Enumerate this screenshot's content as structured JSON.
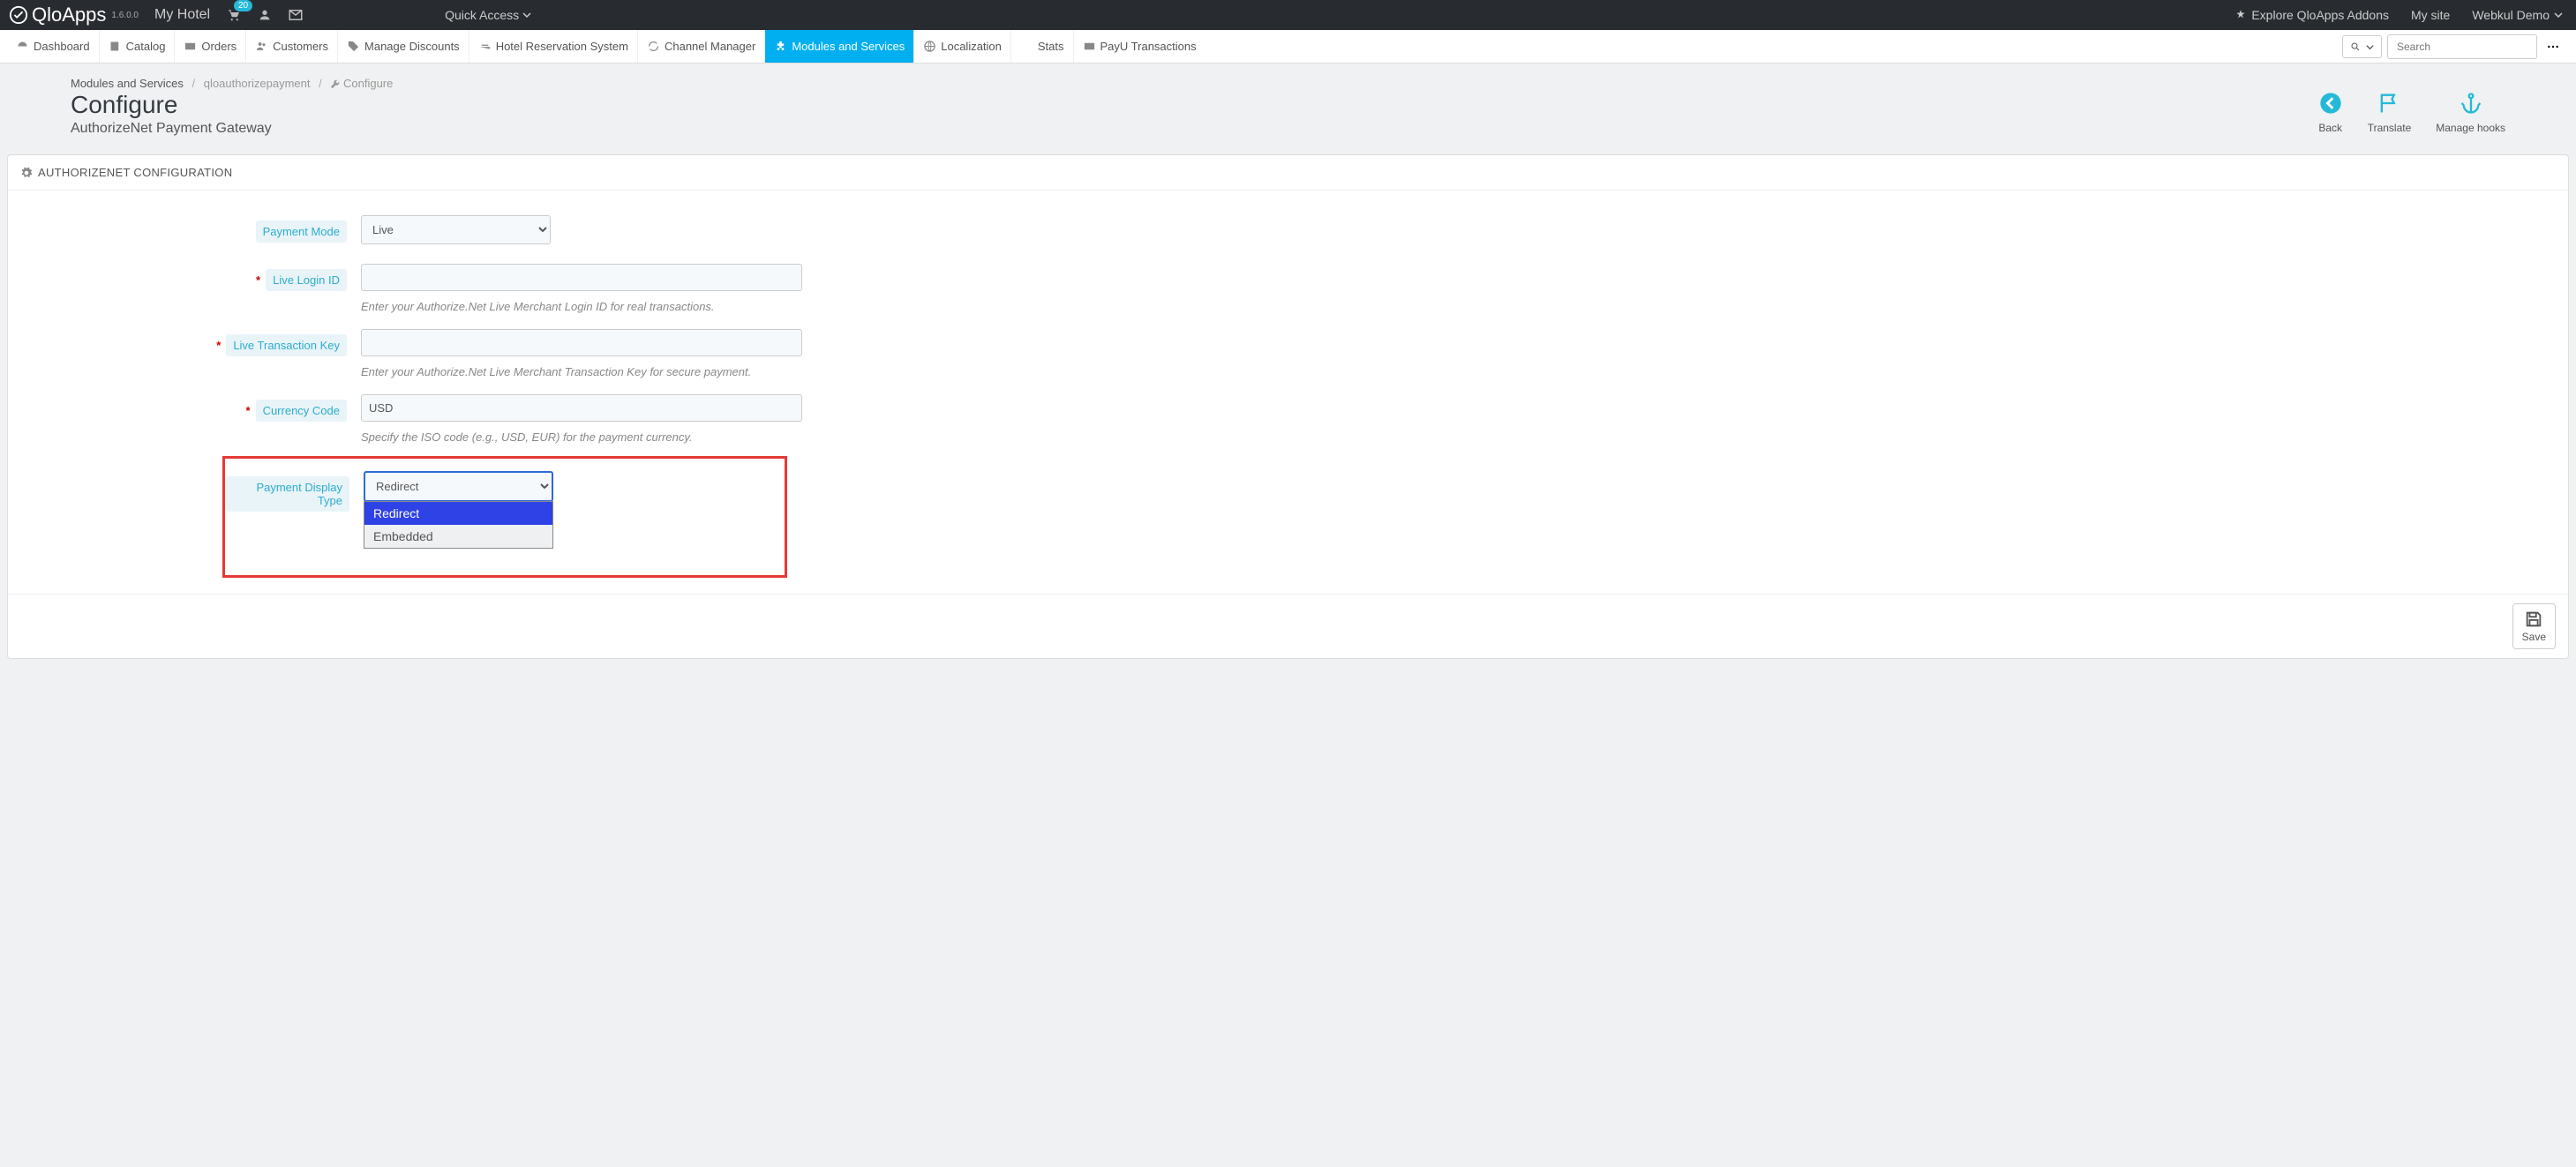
{
  "topbar": {
    "brand": "QloApps",
    "version": "1.6.0.0",
    "hotel": "My Hotel",
    "cart_count": "20",
    "quick_access": "Quick Access",
    "addons": "Explore QloApps Addons",
    "mysite": "My site",
    "user": "Webkul Demo"
  },
  "nav": {
    "items": [
      "Dashboard",
      "Catalog",
      "Orders",
      "Customers",
      "Manage Discounts",
      "Hotel Reservation System",
      "Channel Manager",
      "Modules and Services",
      "Localization",
      "Stats",
      "PayU Transactions"
    ],
    "search_placeholder": "Search"
  },
  "breadcrumb": {
    "root": "Modules and Services",
    "module": "qloauthorizepayment",
    "page": "Configure"
  },
  "header": {
    "title": "Configure",
    "subtitle": "AuthorizeNet Payment Gateway",
    "toolbar": {
      "back": "Back",
      "translate": "Translate",
      "hooks": "Manage hooks"
    }
  },
  "panel": {
    "title": "AUTHORIZENET CONFIGURATION",
    "fields": {
      "payment_mode": {
        "label": "Payment Mode",
        "value": "Live"
      },
      "login_id": {
        "label": "Live Login ID",
        "help": "Enter your Authorize.Net Live Merchant Login ID for real transactions."
      },
      "txn_key": {
        "label": "Live Transaction Key",
        "help": "Enter your Authorize.Net Live Merchant Transaction Key for secure payment."
      },
      "currency": {
        "label": "Currency Code",
        "value": "USD",
        "help": "Specify the ISO code (e.g., USD, EUR) for the payment currency."
      },
      "display_type": {
        "label": "Payment Display Type",
        "value": "Redirect",
        "options": [
          "Redirect",
          "Embedded"
        ]
      }
    },
    "save": "Save"
  }
}
